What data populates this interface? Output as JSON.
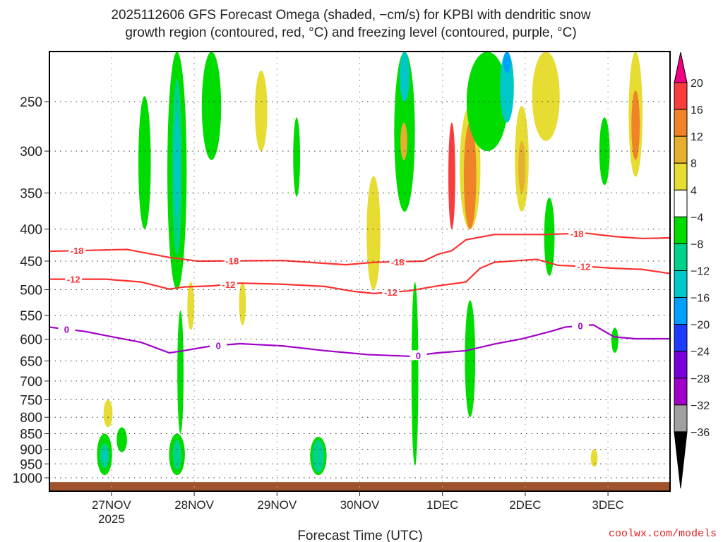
{
  "chart_data": {
    "type": "heatmap",
    "title": [
      "2025112606 GFS Forecast Omega (shaded, −cm/s) for KPBI with dendritic snow",
      "growth region (contoured, red, °C) and freezing level (contoured, purple, °C)"
    ],
    "xlabel": "Forecast Time (UTC)",
    "ylabel": "",
    "credit": "coolwx.com/models",
    "xlim_hours": [
      0,
      180
    ],
    "ylim_hpa": [
      1050,
      208
    ],
    "y_ticks": [
      250,
      300,
      350,
      400,
      450,
      500,
      550,
      600,
      650,
      700,
      750,
      800,
      850,
      900,
      950,
      1000
    ],
    "x_ticks": [
      {
        "hour": 18,
        "label": "27NOV",
        "sub": "2025"
      },
      {
        "hour": 42,
        "label": "28NOV",
        "sub": ""
      },
      {
        "hour": 66,
        "label": "29NOV",
        "sub": ""
      },
      {
        "hour": 90,
        "label": "30NOV",
        "sub": ""
      },
      {
        "hour": 114,
        "label": "1DEC",
        "sub": ""
      },
      {
        "hour": 138,
        "label": "2DEC",
        "sub": ""
      },
      {
        "hour": 162,
        "label": "3DEC",
        "sub": ""
      }
    ],
    "grid": true,
    "surface_pressure": 1016,
    "colorbar": {
      "labels": [
        "20",
        "16",
        "12",
        "8",
        "4",
        "−4",
        "−8",
        "−12",
        "−16",
        "−20",
        "−24",
        "−28",
        "−32",
        "−36"
      ],
      "colors": [
        "#fa3c3c",
        "#f08228",
        "#e6af2d",
        "#e6dc32",
        "#ffffff",
        "#00dc00",
        "#00d28c",
        "#00c8c8",
        "#00a0ff",
        "#1e3cff",
        "#7800dc",
        "#a000c8",
        "#a0a0a0"
      ],
      "over_color": "#f00082",
      "under_color": "#000000"
    },
    "contours": [
      {
        "value": -18,
        "label": "-18",
        "color": "#ff3030",
        "points": [
          [
            0,
            434
          ],
          [
            22.5,
            431
          ],
          [
            34.8,
            444
          ],
          [
            43,
            450
          ],
          [
            67.6,
            449
          ],
          [
            86,
            456
          ],
          [
            94.2,
            452
          ],
          [
            108.5,
            450
          ],
          [
            112.6,
            439
          ],
          [
            116.7,
            433
          ],
          [
            120.8,
            416
          ],
          [
            129,
            408
          ],
          [
            143.4,
            408
          ],
          [
            155.6,
            406
          ],
          [
            163.8,
            411
          ],
          [
            172,
            414
          ],
          [
            180,
            413
          ]
        ],
        "label_hours": [
          8,
          53,
          101,
          153
        ]
      },
      {
        "value": -12,
        "label": "-12",
        "color": "#ff3030",
        "points": [
          [
            0,
            481
          ],
          [
            16.4,
            481
          ],
          [
            26.6,
            486
          ],
          [
            34.8,
            499
          ],
          [
            38.9,
            495
          ],
          [
            47.1,
            493
          ],
          [
            55.3,
            488
          ],
          [
            67.6,
            490
          ],
          [
            79.9,
            494
          ],
          [
            88.1,
            503
          ],
          [
            94.2,
            507
          ],
          [
            104.4,
            502
          ],
          [
            112.6,
            493
          ],
          [
            120.8,
            486
          ],
          [
            124.9,
            462
          ],
          [
            129,
            452
          ],
          [
            141.3,
            447
          ],
          [
            147.5,
            457
          ],
          [
            155.6,
            459
          ],
          [
            163.8,
            462
          ],
          [
            172,
            464
          ],
          [
            180,
            471
          ]
        ],
        "label_hours": [
          7,
          52,
          99,
          155
        ]
      },
      {
        "value": 0,
        "label": "0",
        "color": "#a000c8",
        "points": [
          [
            0,
            574
          ],
          [
            10.2,
            583
          ],
          [
            18.4,
            595
          ],
          [
            26.6,
            607
          ],
          [
            34.8,
            631
          ],
          [
            38.9,
            626
          ],
          [
            47.1,
            615
          ],
          [
            55.3,
            610
          ],
          [
            67.6,
            615
          ],
          [
            79.9,
            626
          ],
          [
            92.2,
            635
          ],
          [
            104.4,
            639
          ],
          [
            112.6,
            631
          ],
          [
            120.8,
            626
          ],
          [
            129,
            611
          ],
          [
            137.2,
            599
          ],
          [
            145.4,
            583
          ],
          [
            149.5,
            574
          ],
          [
            157.7,
            569
          ],
          [
            163.8,
            595
          ],
          [
            170,
            599
          ],
          [
            180,
            599
          ]
        ],
        "label_hours": [
          5,
          49,
          107,
          154
        ]
      }
    ],
    "shaded_regions": [
      {
        "hour": 16,
        "p": [
          850,
          990
        ],
        "hw": 2.2,
        "level": "-4"
      },
      {
        "hour": 16,
        "p": [
          880,
          965
        ],
        "hw": 1.3,
        "level": "-8"
      },
      {
        "hour": 16,
        "p": [
          900,
          945
        ],
        "hw": 0.7,
        "level": "-12"
      },
      {
        "hour": 21,
        "p": [
          830,
          910
        ],
        "hw": 1.5,
        "level": "-4"
      },
      {
        "hour": 17,
        "p": [
          750,
          830
        ],
        "hw": 1.3,
        "level": "4"
      },
      {
        "hour": 37,
        "p": [
          208,
          500
        ],
        "hw": 2.8,
        "level": "-4"
      },
      {
        "hour": 37,
        "p": [
          230,
          440
        ],
        "hw": 1.4,
        "level": "-8"
      },
      {
        "hour": 37,
        "p": [
          260,
          380
        ],
        "hw": 0.7,
        "level": "-12"
      },
      {
        "hour": 37,
        "p": [
          850,
          990
        ],
        "hw": 2.3,
        "level": "-4"
      },
      {
        "hour": 37,
        "p": [
          870,
          970
        ],
        "hw": 1.2,
        "level": "-8"
      },
      {
        "hour": 38,
        "p": [
          540,
          850
        ],
        "hw": 0.9,
        "level": "-4"
      },
      {
        "hour": 27.6,
        "p": [
          245,
          400
        ],
        "hw": 1.8,
        "level": "-4"
      },
      {
        "hour": 47,
        "p": [
          208,
          310
        ],
        "hw": 2.8,
        "level": "-4"
      },
      {
        "hour": 78,
        "p": [
          860,
          990
        ],
        "hw": 2.4,
        "level": "-4"
      },
      {
        "hour": 78,
        "p": [
          870,
          980
        ],
        "hw": 1.7,
        "level": "-8"
      },
      {
        "hour": 61.4,
        "p": [
          223,
          300
        ],
        "hw": 1.8,
        "level": "4"
      },
      {
        "hour": 94,
        "p": [
          329,
          500
        ],
        "hw": 2,
        "level": "4"
      },
      {
        "hour": 103,
        "p": [
          208,
          375
        ],
        "hw": 3,
        "level": "-4"
      },
      {
        "hour": 103,
        "p": [
          208,
          250
        ],
        "hw": 1.4,
        "level": "-12"
      },
      {
        "hour": 102.8,
        "p": [
          270,
          310
        ],
        "hw": 1,
        "level": "8"
      },
      {
        "hour": 106,
        "p": [
          486,
          956
        ],
        "hw": 1,
        "level": "-4"
      },
      {
        "hour": 122,
        "p": [
          254,
          400
        ],
        "hw": 3,
        "level": "4"
      },
      {
        "hour": 116.7,
        "p": [
          270,
          400
        ],
        "hw": 1,
        "level": "16"
      },
      {
        "hour": 122,
        "p": [
          270,
          400
        ],
        "hw": 1.8,
        "level": "12"
      },
      {
        "hour": 122,
        "p": [
          520,
          800
        ],
        "hw": 1.5,
        "level": "-4"
      },
      {
        "hour": 127,
        "p": [
          208,
          300
        ],
        "hw": 6,
        "level": "-4"
      },
      {
        "hour": 132.7,
        "p": [
          208,
          270
        ],
        "hw": 2,
        "level": "-12"
      },
      {
        "hour": 132.7,
        "p": [
          208,
          225
        ],
        "hw": 1,
        "level": "-16"
      },
      {
        "hour": 137,
        "p": [
          254,
          375
        ],
        "hw": 2,
        "level": "4"
      },
      {
        "hour": 137,
        "p": [
          289,
          350
        ],
        "hw": 1,
        "level": "8"
      },
      {
        "hour": 145,
        "p": [
          356,
          475
        ],
        "hw": 1.5,
        "level": "-4"
      },
      {
        "hour": 144,
        "p": [
          208,
          289
        ],
        "hw": 4,
        "level": "4"
      },
      {
        "hour": 161,
        "p": [
          265,
          340
        ],
        "hw": 1.5,
        "level": "-4"
      },
      {
        "hour": 170,
        "p": [
          208,
          330
        ],
        "hw": 2,
        "level": "4"
      },
      {
        "hour": 170,
        "p": [
          240,
          310
        ],
        "hw": 1.2,
        "level": "12"
      },
      {
        "hour": 164,
        "p": [
          575,
          631
        ],
        "hw": 1,
        "level": "-4"
      },
      {
        "hour": 158,
        "p": [
          900,
          960
        ],
        "hw": 1,
        "level": "4"
      },
      {
        "hour": 41,
        "p": [
          486,
          580
        ],
        "hw": 1,
        "level": "4"
      },
      {
        "hour": 56,
        "p": [
          486,
          570
        ],
        "hw": 1,
        "level": "4"
      },
      {
        "hour": 71.7,
        "p": [
          265,
          355
        ],
        "hw": 1,
        "level": "-4"
      }
    ]
  }
}
